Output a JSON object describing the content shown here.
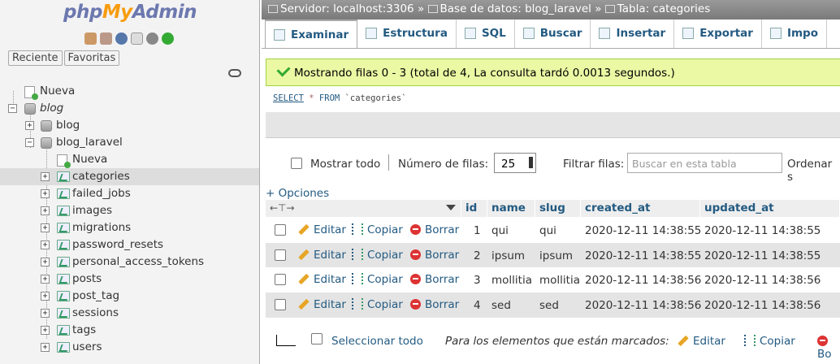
{
  "logo": {
    "php": "php",
    "my": "My",
    "admin": "Admin"
  },
  "nav_icons": [
    "home-icon",
    "logout-icon",
    "help-icon",
    "docs-icon",
    "settings-icon",
    "reload-icon"
  ],
  "nav_tabs": {
    "recent": "Reciente",
    "favorites": "Favoritas"
  },
  "tree": {
    "new_root": "Nueva",
    "db_blog": "blog",
    "db_blog_child": "blog",
    "db_blog_laravel": "blog_laravel",
    "new_table": "Nueva",
    "tables": [
      "categories",
      "failed_jobs",
      "images",
      "migrations",
      "password_resets",
      "personal_access_tokens",
      "posts",
      "post_tag",
      "sessions",
      "tags",
      "users"
    ]
  },
  "breadcrumb": {
    "server": "Servidor: localhost:3306",
    "database": "Base de datos: blog_laravel",
    "table": "Tabla: categories",
    "sep": "»"
  },
  "tabs": [
    "Examinar",
    "Estructura",
    "SQL",
    "Buscar",
    "Insertar",
    "Exportar",
    "Impo"
  ],
  "success_message": "Mostrando filas 0 - 3 (total de 4, La consulta tardó 0.0013 segundos.)",
  "sql": {
    "select": "SELECT",
    "star": "*",
    "from": "FROM",
    "table": "`categories`"
  },
  "navigation": {
    "show_all": "Mostrar todo",
    "rows_label": "Número de filas:",
    "rows_value": "25",
    "filter_label": "Filtrar filas:",
    "filter_placeholder": "Buscar en esta tabla",
    "sort_label": "Ordenar s"
  },
  "options_link": "+ Opciones",
  "table": {
    "columns": [
      "id",
      "name",
      "slug",
      "created_at",
      "updated_at"
    ],
    "actions": {
      "edit": "Editar",
      "copy": "Copiar",
      "delete": "Borrar"
    },
    "rows": [
      [
        "1",
        "qui",
        "qui",
        "2020-12-11 14:38:55",
        "2020-12-11 14:38:55"
      ],
      [
        "2",
        "ipsum",
        "ipsum",
        "2020-12-11 14:38:55",
        "2020-12-11 14:38:55"
      ],
      [
        "3",
        "mollitia",
        "mollitia",
        "2020-12-11 14:38:56",
        "2020-12-11 14:38:56"
      ],
      [
        "4",
        "sed",
        "sed",
        "2020-12-11 14:38:56",
        "2020-12-11 14:38:56"
      ]
    ]
  },
  "footer": {
    "select_all": "Seleccionar todo",
    "with_selected": "Para los elementos que están marcados:",
    "edit": "Editar",
    "copy": "Copiar",
    "delete": "Bo"
  }
}
